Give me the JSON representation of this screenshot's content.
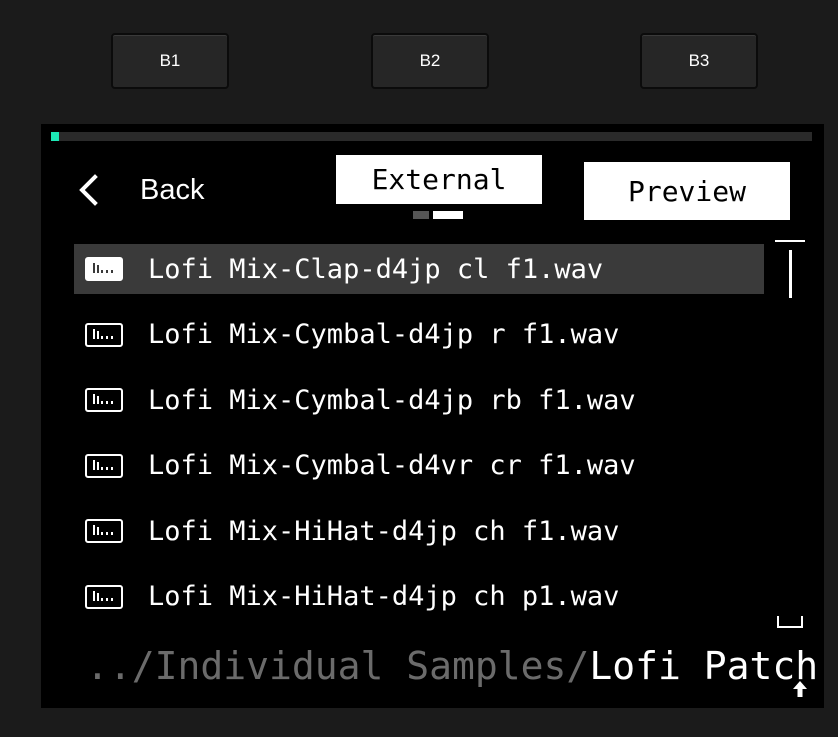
{
  "hardware_buttons": [
    {
      "label": "B1"
    },
    {
      "label": "B2"
    },
    {
      "label": "B3"
    }
  ],
  "screen": {
    "progress": 0.01,
    "accent_color": "#1de9b6",
    "back": {
      "icon": "chevron-left-icon",
      "label": "Back"
    },
    "source_tab": {
      "label": "External",
      "page_count": 2,
      "active_page": 2
    },
    "preview_button": {
      "label": "Preview"
    },
    "files": [
      {
        "name": "Lofi Mix-Clap-d4jp cl f1.wav",
        "icon": "audio-file-icon",
        "selected": true
      },
      {
        "name": "Lofi Mix-Cymbal-d4jp r f1.wav",
        "icon": "audio-file-icon",
        "selected": false
      },
      {
        "name": "Lofi Mix-Cymbal-d4jp rb f1.wav",
        "icon": "audio-file-icon",
        "selected": false
      },
      {
        "name": "Lofi Mix-Cymbal-d4vr cr f1.wav",
        "icon": "audio-file-icon",
        "selected": false
      },
      {
        "name": "Lofi Mix-HiHat-d4jp ch f1.wav",
        "icon": "audio-file-icon",
        "selected": false
      },
      {
        "name": "Lofi Mix-HiHat-d4jp ch p1.wav",
        "icon": "audio-file-icon",
        "selected": false
      }
    ],
    "path": {
      "parent": "../Individual Samples/",
      "current": "Lofi Patch"
    },
    "up_icon": "arrow-up-icon"
  }
}
